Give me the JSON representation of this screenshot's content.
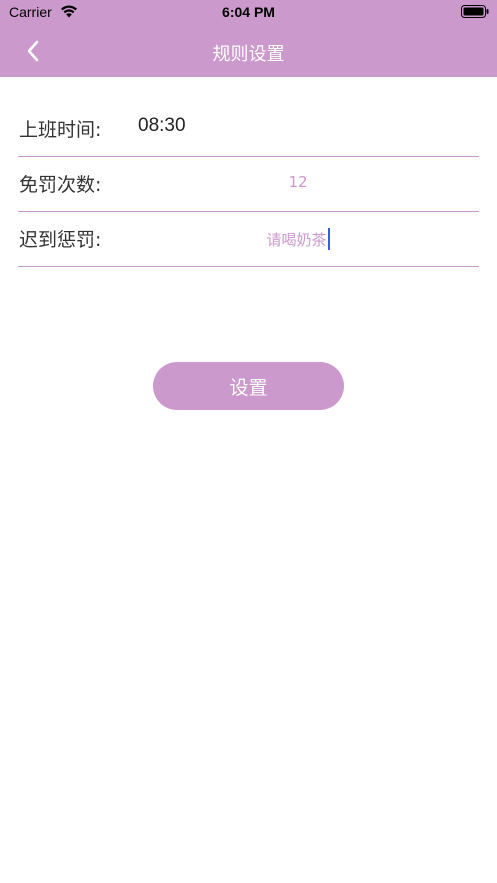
{
  "status_bar": {
    "carrier": "Carrier",
    "time": "6:04 PM"
  },
  "nav": {
    "title": "规则设置",
    "back_icon": "chevron-left-icon"
  },
  "form": {
    "work_time": {
      "label": "上班时间:",
      "value": "08:30"
    },
    "free_count": {
      "label": "免罚次数:",
      "value": "12"
    },
    "penalty": {
      "label": "迟到惩罚:",
      "value": "请喝奶茶"
    }
  },
  "actions": {
    "submit_label": "设置"
  },
  "colors": {
    "accent": "#cc99cc",
    "cursor": "#3b5bdb"
  }
}
